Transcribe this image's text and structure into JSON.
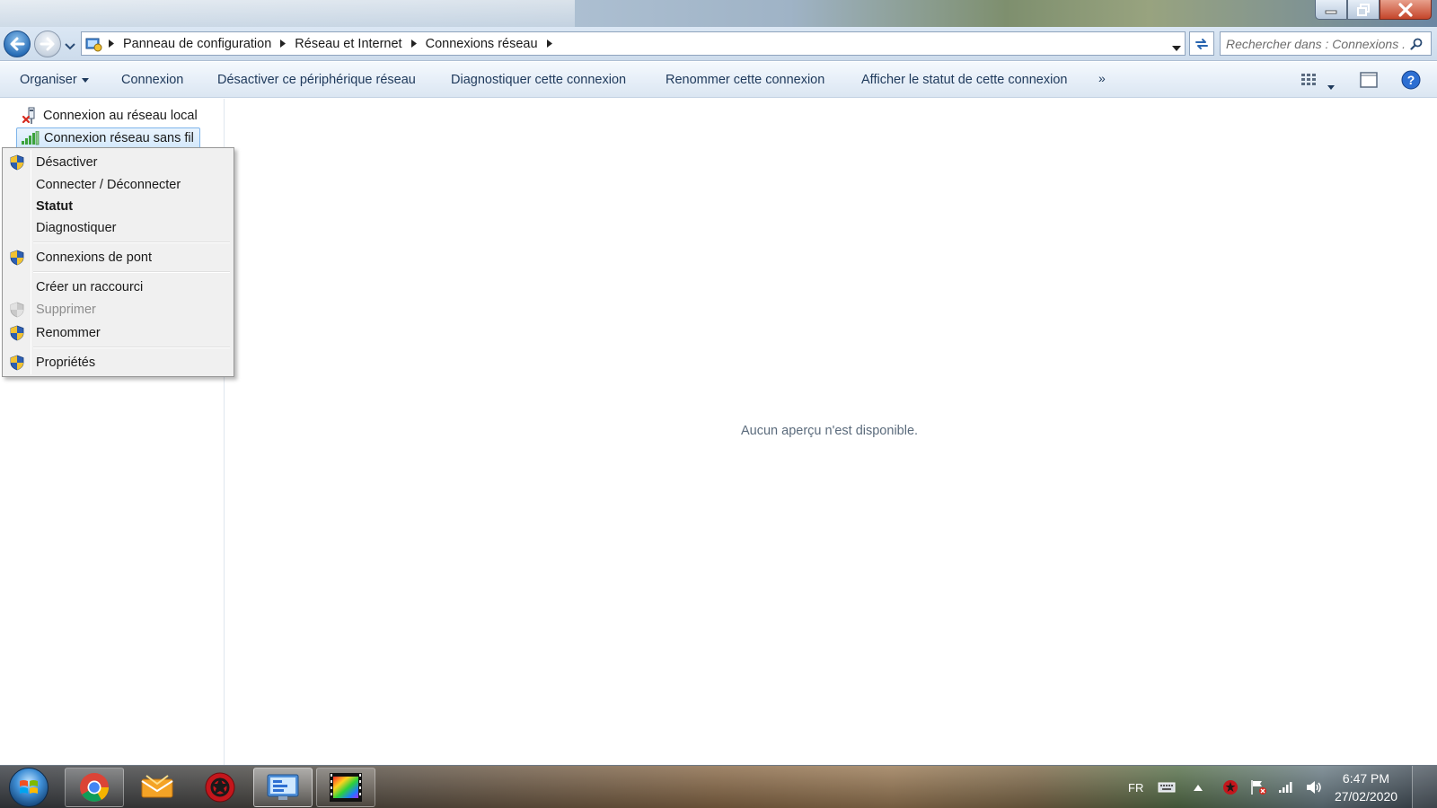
{
  "window": {
    "controls": {
      "minimize_icon": "minimize-icon",
      "maximize_icon": "restore-icon",
      "close_icon": "close-icon"
    }
  },
  "addressbar": {
    "breadcrumbs": [
      "Panneau de configuration",
      "Réseau et Internet",
      "Connexions réseau"
    ],
    "search_placeholder": "Rechercher dans : Connexions ..."
  },
  "commandbar": {
    "organize": "Organiser",
    "items": [
      "Connexion",
      "Désactiver ce périphérique réseau",
      "Diagnostiquer cette connexion",
      "Renommer cette connexion",
      "Afficher le statut de cette connexion"
    ],
    "more": "»"
  },
  "connections": [
    {
      "label": "Connexion au réseau local",
      "icon": "wired-network-icon",
      "selected": false
    },
    {
      "label": "Connexion réseau sans fil",
      "icon": "wireless-signal-icon",
      "selected": true
    }
  ],
  "context_menu": {
    "items": [
      {
        "label": "Désactiver",
        "shield": true,
        "bold": false,
        "disabled": false
      },
      {
        "label": "Connecter / Déconnecter",
        "shield": false,
        "bold": false,
        "disabled": false
      },
      {
        "label": "Statut",
        "shield": false,
        "bold": true,
        "disabled": false
      },
      {
        "label": "Diagnostiquer",
        "shield": false,
        "bold": false,
        "disabled": false
      },
      {
        "label": "Connexions de pont",
        "shield": true,
        "bold": false,
        "disabled": false
      },
      {
        "label": "Créer un raccourci",
        "shield": false,
        "bold": false,
        "disabled": false
      },
      {
        "label": "Supprimer",
        "shield": true,
        "bold": false,
        "disabled": true
      },
      {
        "label": "Renommer",
        "shield": true,
        "bold": false,
        "disabled": false
      },
      {
        "label": "Propriétés",
        "shield": true,
        "bold": false,
        "disabled": false
      }
    ]
  },
  "preview": {
    "message": "Aucun aperçu n'est disponible."
  },
  "taskbar": {
    "apps": [
      {
        "name": "chrome-icon",
        "state": "pinned"
      },
      {
        "name": "mail-icon",
        "state": "normal"
      },
      {
        "name": "red-app-icon",
        "state": "normal"
      },
      {
        "name": "control-panel-icon",
        "state": "active"
      },
      {
        "name": "video-editor-icon",
        "state": "pinned"
      }
    ],
    "tray": {
      "language": "FR"
    },
    "clock": {
      "time": "6:47 PM",
      "date": "27/02/2020"
    }
  },
  "colors": {
    "accent": "#1e395b",
    "selection_border": "#7eb4ea",
    "shield_blue": "#2d5fb3",
    "shield_yellow": "#f2c230"
  }
}
